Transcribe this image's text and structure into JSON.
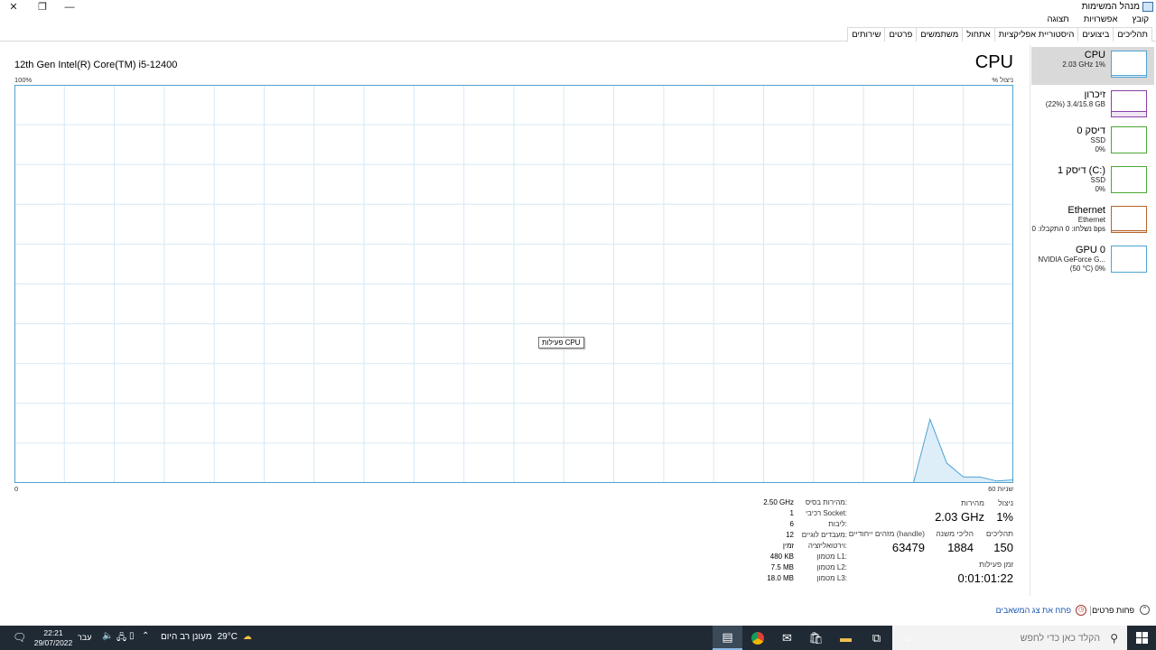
{
  "window": {
    "title": "מנהל המשימות",
    "controls": {
      "close": "✕",
      "restore": "❐",
      "minimize": "—"
    }
  },
  "menu": [
    "קובץ",
    "אפשרויות",
    "תצוגה"
  ],
  "tabs": [
    "תהליכים",
    "ביצועים",
    "היסטוריית אפליקציות",
    "אתחול",
    "משתמשים",
    "פרטים",
    "שירותים"
  ],
  "active_tab": 1,
  "sidebar": {
    "items": [
      {
        "title": "CPU",
        "sub1": "2.03 GHz 1%",
        "sub2": "",
        "color": "#4fa3d1",
        "level": 0.01
      },
      {
        "title": "זיכרון",
        "sub1": "(22%) 3.4/15.8 GB",
        "sub2": "",
        "color": "#8b3fa8",
        "level": 0.22
      },
      {
        "title": "דיסק 0",
        "sub1": "SSD",
        "sub2": "0%",
        "color": "#4aa832",
        "level": 0
      },
      {
        "title": "דיסק 1 (C:)",
        "sub1": "SSD",
        "sub2": "0%",
        "color": "#4aa832",
        "level": 0
      },
      {
        "title": "Ethernet",
        "sub1": "Ethernet",
        "sub2": "נשלחו: 0 התקבלו: 0 bps",
        "color": "#b8642a",
        "level": 0.03
      },
      {
        "title": "GPU 0",
        "sub1": "NVIDIA GeForce G...",
        "sub2": "(50 °C) 0%",
        "color": "#4fa3d1",
        "level": 0
      }
    ]
  },
  "main": {
    "heading": "CPU",
    "model": "12th Gen Intel(R) Core(TM) i5-12400",
    "y_max_label": "100%",
    "y_axis_label": "% ניצול",
    "x_left_label": "0",
    "x_right_label": "60 שניות",
    "tooltip": "פעילות CPU"
  },
  "chart_data": {
    "type": "area",
    "y_label": "% ניצול",
    "x_label": "60 שניות",
    "ylim": [
      0,
      100
    ],
    "xlim": [
      0,
      60
    ],
    "grid": true,
    "color": "#4fa3d1",
    "x": [
      0,
      2,
      4,
      6,
      8,
      10,
      12,
      14,
      16,
      18,
      20,
      22,
      24,
      26,
      28,
      30,
      32,
      34,
      36,
      38,
      40,
      42,
      44,
      46,
      48,
      50,
      52,
      53,
      54,
      55,
      56,
      57,
      58,
      59,
      60
    ],
    "values": [
      0,
      0,
      0,
      0,
      0,
      0,
      0,
      0,
      0,
      0,
      0,
      0,
      0,
      0,
      0,
      0,
      0,
      0,
      0,
      0,
      0,
      0,
      0,
      0,
      0,
      0,
      0,
      0,
      0,
      16,
      5,
      1.5,
      1.5,
      0.5,
      0.8
    ]
  },
  "stats": {
    "utilization_label": "ניצול",
    "utilization": "1%",
    "speed_label": "מהירות",
    "speed": "2.03 GHz",
    "processes_label": "תהליכים",
    "processes": "150",
    "threads_label": "הליכי משנה",
    "threads": "1884",
    "handles_label": "מזהים ייחודיים (handle)",
    "handles": "63479",
    "uptime_label": "זמן פעילות",
    "uptime": "0:01:01:22"
  },
  "specs": [
    {
      "label": "מהירות בסיס:",
      "value": "2.50 GHz"
    },
    {
      "label": "רכיבי Socket:",
      "value": "1"
    },
    {
      "label": "ליבות:",
      "value": "6"
    },
    {
      "label": "מעבדים לוגיים:",
      "value": "12"
    },
    {
      "label": "וירטואליזציה:",
      "value": "זמין"
    },
    {
      "label": "מטמון L1:",
      "value": "480 KB"
    },
    {
      "label": "מטמון L2:",
      "value": "7.5 MB"
    },
    {
      "label": "מטמון L3:",
      "value": "18.0 MB"
    }
  ],
  "footer": {
    "fewer_details": "פחות פרטים",
    "open_monitor": "פתח את צג המשאבים"
  },
  "taskbar": {
    "search_placeholder": "הקלד כאן כדי לחפש",
    "weather_text": "מעונן רב היום",
    "temperature": "29°C",
    "language": "עבר",
    "time": "22:21",
    "date": "29/07/2022"
  }
}
